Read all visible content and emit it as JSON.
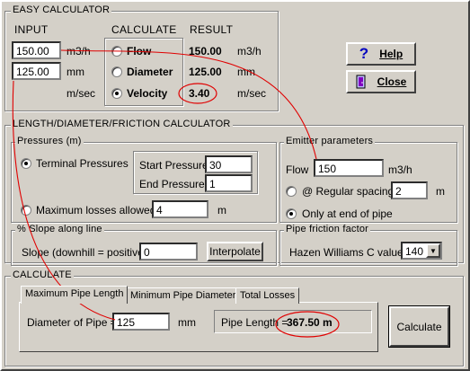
{
  "easy": {
    "title": "EASY CALCULATOR",
    "input_header": "INPUT",
    "calc_header": "CALCULATE",
    "result_header": "RESULT",
    "input1_value": "150.00",
    "input1_unit": "m3/h",
    "input2_value": "125.00",
    "input2_unit": "mm",
    "input3_unit": "m/sec",
    "options": [
      {
        "label": "Flow",
        "selected": false
      },
      {
        "label": "Diameter",
        "selected": false
      },
      {
        "label": "Velocity",
        "selected": true
      }
    ],
    "results": [
      {
        "value": "150.00",
        "unit": "m3/h"
      },
      {
        "value": "125.00",
        "unit": "mm"
      },
      {
        "value": "3.40",
        "unit": "m/sec"
      }
    ]
  },
  "buttons": {
    "help_label": "Help",
    "close_label": "Close",
    "interpolate_label": "Interpolate",
    "calculate_label": "Calculate"
  },
  "ldf": {
    "title": "LENGTH/DIAMETER/FRICTION CALCULATOR",
    "pressures": {
      "title": "Pressures (m)",
      "terminal_label": "Terminal Pressures",
      "terminal_selected": true,
      "start_label": "Start Pressure",
      "start_value": "30",
      "end_label": "End Pressure",
      "end_value": "1",
      "max_label": "Maximum losses allowed",
      "max_selected": false,
      "max_value": "4",
      "max_unit": "m"
    },
    "emitter": {
      "title": "Emitter parameters",
      "flow_label": "Flow",
      "flow_value": "150",
      "flow_unit": "m3/h",
      "regular_label": "@ Regular spacing",
      "regular_selected": false,
      "regular_value": "2",
      "regular_unit": "m",
      "end_label": "Only at end of pipe",
      "end_selected": true
    },
    "slope": {
      "title": "% Slope along line",
      "label": "Slope (downhill = positive)",
      "value": "0"
    },
    "friction": {
      "title": "Pipe friction factor",
      "label": "Hazen Williams C value",
      "value": "140"
    }
  },
  "calc": {
    "title": "CALCULATE",
    "tabs": [
      "Maximum Pipe Length",
      "Minimum Pipe Diameter",
      "Total Losses"
    ],
    "active_tab": 0,
    "diameter_label": "Diameter of Pipe =",
    "diameter_value": "125",
    "diameter_unit": "mm",
    "length_label": "Pipe Length =",
    "length_value": "367.50 m"
  },
  "colors": {
    "annotation": "#e00000",
    "face": "#d4d0c8",
    "help_icon": "#0000c0"
  },
  "icons": [
    "question-mark-icon",
    "door-exit-icon"
  ]
}
